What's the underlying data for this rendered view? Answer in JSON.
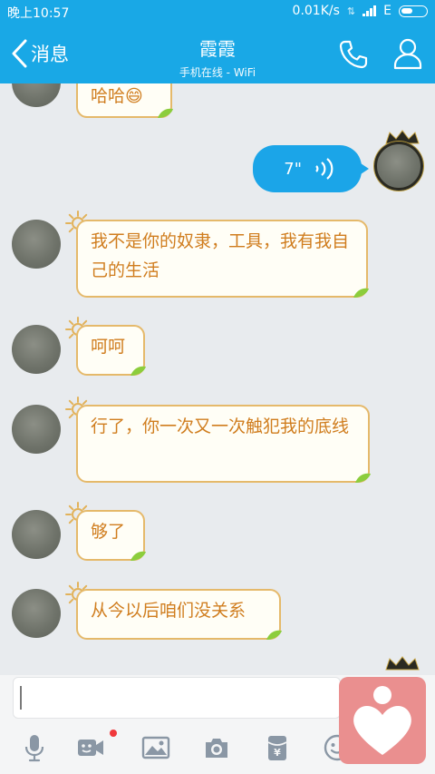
{
  "status_bar": {
    "time": "晚上10:57",
    "speed": "0.01K/s",
    "network": "E"
  },
  "header": {
    "back_label": "消息",
    "title": "霞霞",
    "subtitle": "手机在线 - WiFi"
  },
  "messages": [
    {
      "side": "left",
      "text": "哈哈😄"
    },
    {
      "side": "right",
      "type": "voice",
      "duration": "7\""
    },
    {
      "side": "left",
      "text": "我不是你的奴隶，工具，我有我自己的生活"
    },
    {
      "side": "left",
      "text": "呵呵"
    },
    {
      "side": "left",
      "text": "行了，你一次又一次触犯我的底线"
    },
    {
      "side": "left",
      "text": "够了"
    },
    {
      "side": "left",
      "text": "从今以后咱们没关系"
    }
  ],
  "input": {
    "value": "",
    "placeholder": ""
  },
  "toolbar": [
    "mic-icon",
    "video-icon",
    "image-icon",
    "camera-icon",
    "red-packet-icon",
    "emoji-icon"
  ],
  "colors": {
    "header": "#19a8e6",
    "bubble_text": "#d07d1e",
    "bubble_border": "#e5b96a",
    "sent_bubble": "#1ba5e8",
    "floating_button": "#ea8f8f"
  }
}
